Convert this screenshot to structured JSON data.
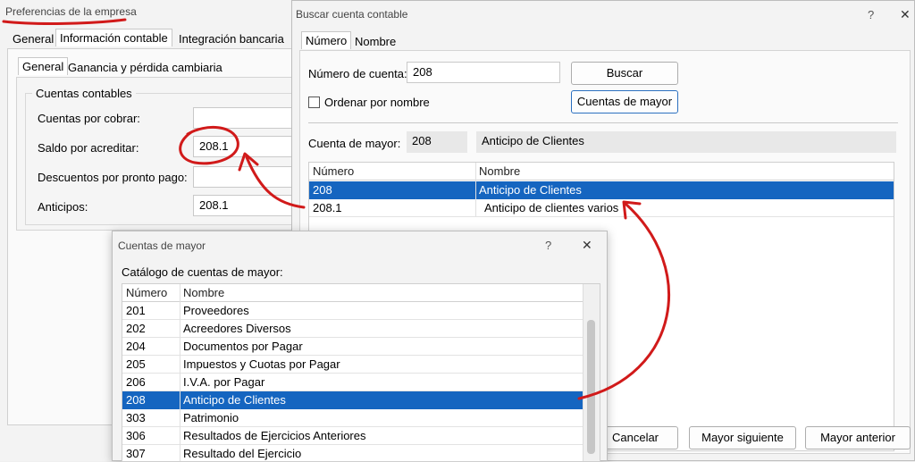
{
  "bg_window": {
    "title": "Preferencias de la empresa",
    "tabs": [
      "General",
      "Información contable",
      "Integración bancaria"
    ],
    "subtabs": [
      "General",
      "Ganancia y pérdida cambiaria"
    ],
    "group_title": "Cuentas contables",
    "fields": [
      {
        "label": "Cuentas por cobrar:",
        "value": ""
      },
      {
        "label": "Saldo por acreditar:",
        "value": "208.1"
      },
      {
        "label": "Descuentos por pronto pago:",
        "value": ""
      },
      {
        "label": "Anticipos:",
        "value": "208.1"
      }
    ]
  },
  "buscar_dialog": {
    "title": "Buscar cuenta contable",
    "help": "?",
    "close": "✕",
    "tabs": [
      "Número",
      "Nombre"
    ],
    "numero_label": "Número de cuenta:",
    "numero_value": "208",
    "buscar_button": "Buscar",
    "ordenar_label": "Ordenar por nombre",
    "cuentas_mayor_button": "Cuentas de mayor",
    "cuenta_mayor_label": "Cuenta de mayor:",
    "cuenta_mayor_num": "208",
    "cuenta_mayor_name": "Anticipo de Clientes",
    "columns": [
      "Número",
      "Nombre"
    ],
    "rows": [
      {
        "num": "208",
        "name": "Anticipo de Clientes",
        "selected": true
      },
      {
        "num": "208.1",
        "name": "Anticipo de clientes varios",
        "selected": false
      }
    ],
    "bottom_buttons": [
      "Cancelar",
      "Mayor siguiente",
      "Mayor anterior"
    ]
  },
  "mayor_dialog": {
    "title": "Cuentas de mayor",
    "help": "?",
    "close": "✕",
    "catalog_label": "Catálogo de cuentas de mayor:",
    "columns": [
      "Número",
      "Nombre"
    ],
    "rows": [
      {
        "num": "201",
        "name": "Proveedores",
        "selected": false
      },
      {
        "num": "202",
        "name": "Acreedores Diversos",
        "selected": false
      },
      {
        "num": "204",
        "name": "Documentos por Pagar",
        "selected": false
      },
      {
        "num": "205",
        "name": "Impuestos y Cuotas por Pagar",
        "selected": false
      },
      {
        "num": "206",
        "name": "I.V.A. por Pagar",
        "selected": false
      },
      {
        "num": "208",
        "name": "Anticipo de Clientes",
        "selected": true
      },
      {
        "num": "303",
        "name": "Patrimonio",
        "selected": false
      },
      {
        "num": "306",
        "name": "Resultados de Ejercicios Anteriores",
        "selected": false
      },
      {
        "num": "307",
        "name": "Resultado del Ejercicio",
        "selected": false
      }
    ]
  },
  "annotation_color": "#d11a1a",
  "selection_color": "#1565c0"
}
